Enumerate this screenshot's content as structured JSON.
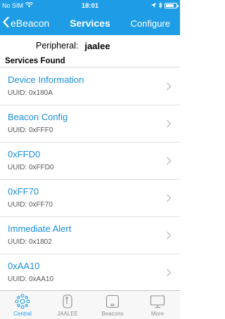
{
  "status_bar": {
    "carrier": "No SIM",
    "time": "18:01",
    "battery_level": 0.8
  },
  "nav": {
    "back_label": "eBeacon",
    "title": "Services",
    "right_label": "Configure"
  },
  "peripheral": {
    "label": "Peripheral:",
    "value": "jaalee"
  },
  "section_header": "Services Found",
  "services": [
    {
      "name": "Device Information",
      "uuid": "UUID: 0x180A"
    },
    {
      "name": "Beacon Config",
      "uuid": "UUID: 0xFFF0"
    },
    {
      "name": "0xFFD0",
      "uuid": "UUID: 0xFFD0"
    },
    {
      "name": "0xFF70",
      "uuid": "UUID: 0xFF70"
    },
    {
      "name": "Immediate Alert",
      "uuid": "UUID: 0x1802"
    },
    {
      "name": "0xAA10",
      "uuid": "UUID: 0xAA10"
    }
  ],
  "tabs": [
    {
      "label": "Central",
      "icon": "central-icon",
      "active": true
    },
    {
      "label": "JAALEE",
      "icon": "jaalee-icon",
      "active": false
    },
    {
      "label": "Beacons",
      "icon": "beacons-icon",
      "active": false
    },
    {
      "label": "More",
      "icon": "more-icon",
      "active": false
    }
  ],
  "colors": {
    "accent": "#1e9de6",
    "service_name": "#1a8fdc",
    "tab_inactive": "#8e8e8e"
  }
}
